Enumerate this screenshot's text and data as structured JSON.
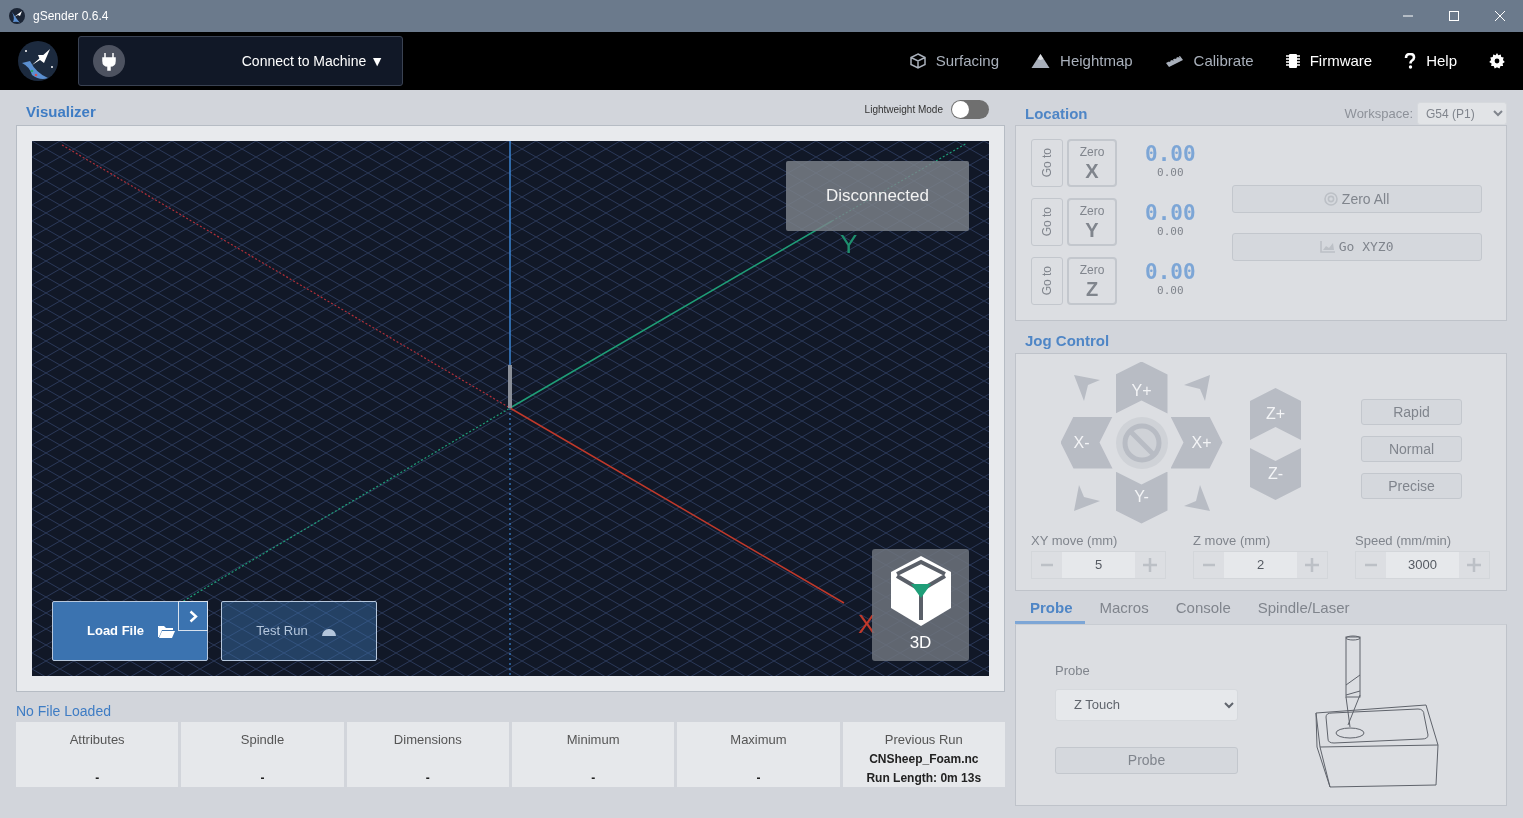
{
  "window": {
    "title": "gSender 0.6.4"
  },
  "toolbar": {
    "connect": {
      "label": "Connect to Machine ▼"
    },
    "nav": [
      {
        "label": "Surfacing",
        "kind": "surfacing",
        "disabled": true
      },
      {
        "label": "Heightmap",
        "kind": "heightmap",
        "disabled": true
      },
      {
        "label": "Calibrate",
        "kind": "calibrate",
        "disabled": true
      },
      {
        "label": "Firmware",
        "kind": "firmware",
        "disabled": false
      },
      {
        "label": "Help",
        "kind": "help",
        "disabled": false
      }
    ]
  },
  "visualizer": {
    "title": "Visualizer",
    "lightweight_mode": {
      "label": "Lightweight Mode",
      "on": false
    },
    "status": "Disconnected",
    "axis_labels": [
      {
        "label": "Y",
        "color": "#1e8f6e"
      },
      {
        "label": "X",
        "color": "#c0392b"
      }
    ],
    "view_button": "3D",
    "load_button": "Load File",
    "test_button": {
      "label": "Test Run",
      "disabled": true
    }
  },
  "file_info": {
    "title": "No File Loaded",
    "columns": [
      {
        "heading": "Attributes",
        "value": "-"
      },
      {
        "heading": "Spindle",
        "value": "-"
      },
      {
        "heading": "Dimensions",
        "value": "-"
      },
      {
        "heading": "Minimum",
        "value": "-"
      },
      {
        "heading": "Maximum",
        "value": "-"
      },
      {
        "heading": "Previous Run",
        "value": "CNSheep_Foam.nc",
        "detail": "Run Length: 0m 13s"
      }
    ]
  },
  "location": {
    "title": "Location",
    "workspace_label": "Workspace:",
    "workspace": "G54 (P1)",
    "axes": [
      {
        "goto": "Go to",
        "zero": "Zero",
        "axis": "X",
        "value": "0.00",
        "machine_value": "0.00"
      },
      {
        "goto": "Go to",
        "zero": "Zero",
        "axis": "Y",
        "value": "0.00",
        "machine_value": "0.00"
      },
      {
        "goto": "Go to",
        "zero": "Zero",
        "axis": "Z",
        "value": "0.00",
        "machine_value": "0.00"
      }
    ],
    "zero_all": "Zero All",
    "go_zero": "Go XYZ0"
  },
  "jog": {
    "title": "Jog Control",
    "pad": {
      "up": "Y+",
      "left": "X-",
      "right": "X+",
      "down": "Y-"
    },
    "z": [
      "Z+",
      "Z-"
    ],
    "speeds": [
      {
        "label": "Rapid",
        "selected": false
      },
      {
        "label": "Normal",
        "selected": false
      },
      {
        "label": "Precise",
        "selected": false
      }
    ],
    "inputs": [
      {
        "label": "XY move (mm)",
        "value": "5"
      },
      {
        "label": "Z move (mm)",
        "value": "2"
      },
      {
        "label": "Speed (mm/min)",
        "value": "3000"
      }
    ]
  },
  "tabs": [
    {
      "label": "Probe",
      "selected": true
    },
    {
      "label": "Macros",
      "selected": false
    },
    {
      "label": "Console",
      "selected": false
    },
    {
      "label": "Spindle/Laser",
      "selected": false
    }
  ],
  "probe": {
    "label": "Probe",
    "select": "Z Touch",
    "button": "Probe"
  }
}
